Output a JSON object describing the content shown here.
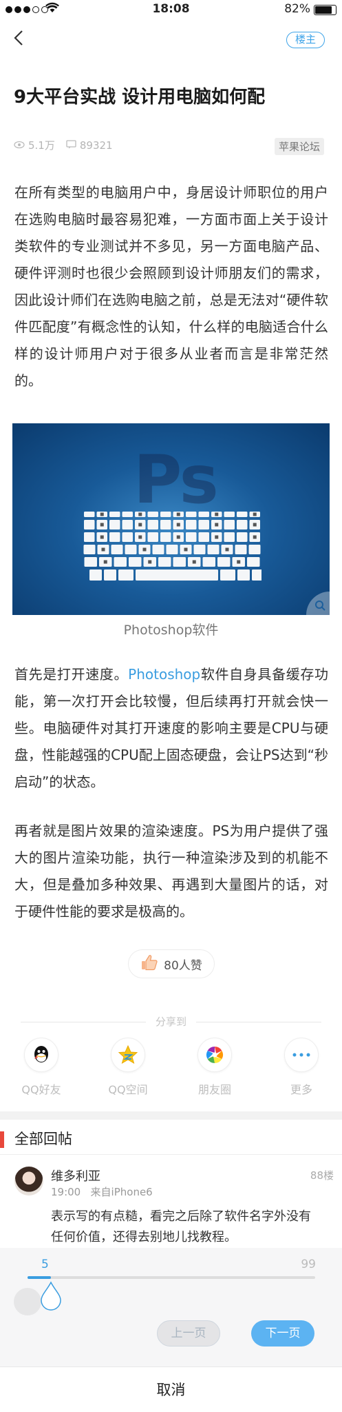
{
  "status_bar": {
    "time": "18:08",
    "battery": "82%",
    "signal_bars": 3
  },
  "nav": {
    "owner_label": "楼主"
  },
  "post": {
    "title": "9大平台实战 设计用电脑如何配",
    "views": "5.1万",
    "comments": "89321",
    "forum": "苹果论坛",
    "paragraph1": "在所有类型的电脑用户中，身居设计师职位的用户在选购电脑时最容易犯难，一方面市面上关于设计类软件的专业测试并不多见，另一方面电脑产品、硬件评测时也很少会照顾到设计师朋友们的需求，因此设计师们在选购电脑之前，总是无法对“硬件软件匹配度”有概念性的认知，什么样的电脑适合什么样的设计师用户对于很多从业者而言是非常茫然的。",
    "image_logo": "Ps",
    "image_caption": "Photoshop软件",
    "paragraph2_before": "首先是打开速度。",
    "paragraph2_link": "Photoshop",
    "paragraph2_after": "软件自身具备缓存功能，第一次打开会比较慢，但后续再打开就会快一些。电脑硬件对其打开速度的影响主要是CPU与硬盘，性能越强的CPU配上固态硬盘，会让PS达到“秒启动”的状态。",
    "paragraph3": "再者就是图片效果的渲染速度。PS为用户提供了强大的图片渲染功能，执行一种渲染涉及到的机能不大，但是叠加多种效果、再遇到大量图片的话，对于硬件性能的要求是极高的。",
    "likes": "80人赞"
  },
  "share": {
    "title": "分享到",
    "items": [
      {
        "label": "QQ好友",
        "icon": "qq-icon"
      },
      {
        "label": "QQ空间",
        "icon": "qzone-star-icon"
      },
      {
        "label": "朋友圈",
        "icon": "moments-aperture-icon"
      },
      {
        "label": "更多",
        "icon": "more-dots-icon"
      }
    ]
  },
  "replies": {
    "title": "全部回帖",
    "items": [
      {
        "user": "维多利亚",
        "floor": "88楼",
        "time": "19:00",
        "device": "来自iPhone6",
        "content": "表示写的有点糙，看完之后除了软件名字外没有任何价值，还得去别地儿找教程。"
      }
    ]
  },
  "pager": {
    "current": "5",
    "max": "99",
    "progress_fraction": 0.05,
    "prev_label": "上一页",
    "next_label": "下一页",
    "cancel_label": "取消"
  },
  "colors": {
    "accent": "#3a9de0",
    "reply_bar": "#e8483b"
  }
}
